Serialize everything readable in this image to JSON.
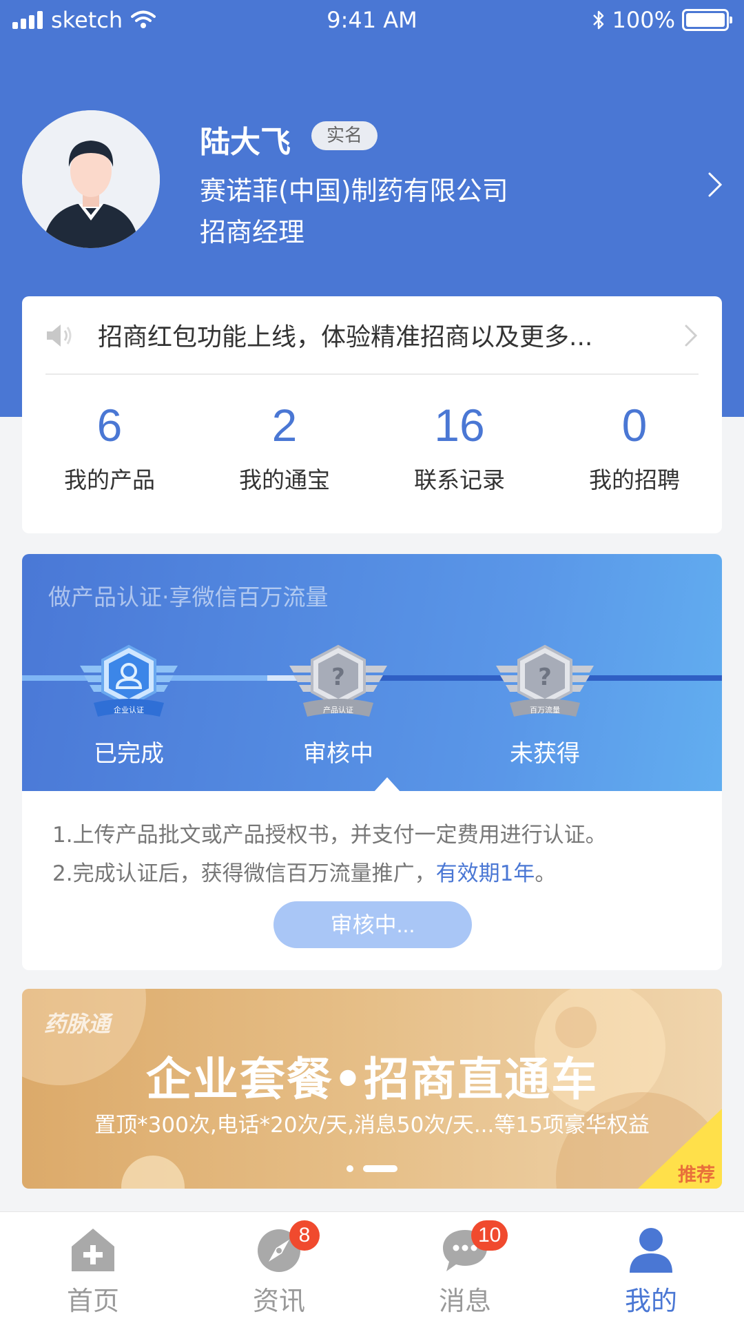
{
  "status_bar": {
    "carrier": "sketch",
    "time": "9:41 AM",
    "battery": "100%",
    "icons": [
      "signal-icon",
      "wifi-icon",
      "bluetooth-icon",
      "battery-icon"
    ]
  },
  "profile": {
    "name": "陆大飞",
    "badge": "实名",
    "company": "赛诺菲(中国)制药有限公司",
    "title": "招商经理"
  },
  "notice": {
    "text": "招商红包功能上线，体验精准招商以及更多..."
  },
  "stats": [
    {
      "value": "6",
      "label": "我的产品"
    },
    {
      "value": "2",
      "label": "我的通宝"
    },
    {
      "value": "16",
      "label": "联系记录"
    },
    {
      "value": "0",
      "label": "我的招聘"
    }
  ],
  "certification": {
    "headline": "做产品认证·享微信百万流量",
    "badges": [
      {
        "label": "企业认证",
        "status": "已完成"
      },
      {
        "label": "产品认证",
        "status": "审核中"
      },
      {
        "label": "百万流量",
        "status": "未获得"
      }
    ],
    "line1": "1.上传产品批文或产品授权书，并支付一定费用进行认证。",
    "line2_prefix": "2.完成认证后，获得微信百万流量推广，",
    "line2_highlight": "有效期1年",
    "line2_suffix": "。",
    "button": "审核中..."
  },
  "promo": {
    "brand": "药脉通",
    "title": "企业套餐•招商直通车",
    "subtitle": "置顶*300次,电话*20次/天,消息50次/天...等15项豪华权益",
    "tag": "推荐",
    "slide_count": 2,
    "active_slide": 2
  },
  "tabbar": {
    "tabs": [
      {
        "label": "首页",
        "icon": "home-icon",
        "badge": ""
      },
      {
        "label": "资讯",
        "icon": "compass-icon",
        "badge": "8"
      },
      {
        "label": "消息",
        "icon": "chat-bubble-icon",
        "badge": "10"
      },
      {
        "label": "我的",
        "icon": "person-icon",
        "badge": ""
      }
    ],
    "active": "我的"
  },
  "colors": {
    "primary": "#4a77d4",
    "badge_red": "#f04a2e",
    "promo_orange": "#e8703a",
    "button_disabled": "#a9c6f6"
  }
}
